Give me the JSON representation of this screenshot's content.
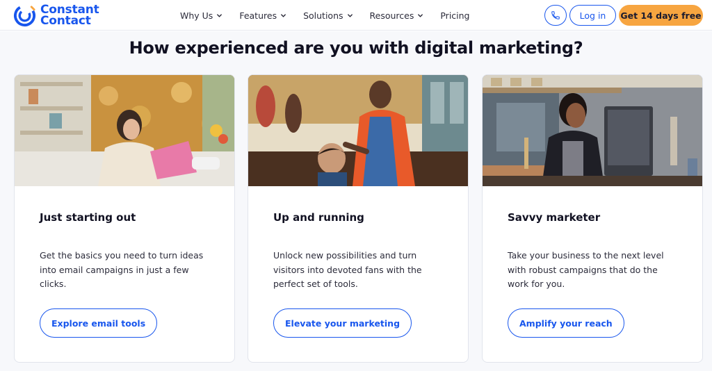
{
  "brand": {
    "name_line1": "Constant",
    "name_line2": "Contact",
    "color": "#1856ed",
    "logo_icon": "constant-contact-logo-icon"
  },
  "nav": {
    "items": [
      {
        "label": "Why Us",
        "has_dropdown": true
      },
      {
        "label": "Features",
        "has_dropdown": true
      },
      {
        "label": "Solutions",
        "has_dropdown": true
      },
      {
        "label": "Resources",
        "has_dropdown": true
      },
      {
        "label": "Pricing",
        "has_dropdown": false
      }
    ],
    "phone_icon": "phone-icon",
    "login_label": "Log in",
    "trial_label": "Get 14 days free",
    "trial_color": "#f7a540"
  },
  "main": {
    "heading": "How experienced are you with digital marketing?",
    "cards": [
      {
        "image": "woman-at-laptop-photo",
        "title": "Just starting out",
        "description": "Get the basics you need to turn ideas into email campaigns in just a few clicks.",
        "button": "Explore email tools"
      },
      {
        "image": "barber-with-child-photo",
        "title": "Up and running",
        "description": "Unlock new possibilities and turn visitors into devoted fans with the perfect set of tools.",
        "button": "Elevate your marketing"
      },
      {
        "image": "woman-at-counter-photo",
        "title": "Savvy marketer",
        "description": "Take your business to the next level with robust campaigns that do the work for you.",
        "button": "Amplify your reach"
      }
    ]
  }
}
